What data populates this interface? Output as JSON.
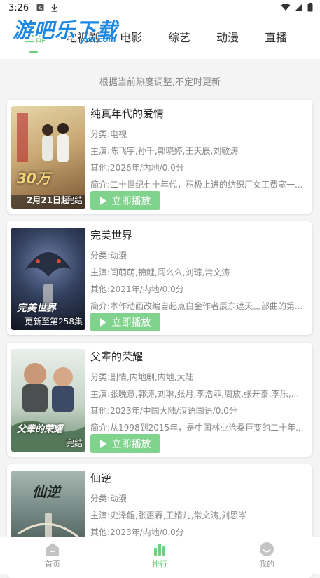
{
  "status_bar": {
    "time": "3:26",
    "icons": [
      "notification-a-icon",
      "download-icon",
      "wifi-icon",
      "signal-icon",
      "battery-icon"
    ]
  },
  "watermark": {
    "main": "游吧乐下载",
    "sub": "yx8.com"
  },
  "tabs": [
    {
      "label": "全部",
      "active": true
    },
    {
      "label": "电视剧",
      "active": false
    },
    {
      "label": "电影",
      "active": false
    },
    {
      "label": "综艺",
      "active": false
    },
    {
      "label": "动漫",
      "active": false
    },
    {
      "label": "直播",
      "active": false
    }
  ],
  "hint": "根据当前热度调整,不定时更新",
  "items": [
    {
      "title": "纯真年代的爱情",
      "category": "分类:电视",
      "cast": "主演:陈飞宇,孙千,郭晓婷,王天辰,刘敏涛",
      "other": "其他:2026年/内地/0.0分",
      "intro": "简介:二十世纪七十年代，积极上进的纺织厂女工费宽一...",
      "badge": "完结",
      "poster_text": "30万",
      "poster_bottom": "2月21日起",
      "play_label": "立即播放",
      "colors": [
        "#c9b27a",
        "#8a5f3a"
      ]
    },
    {
      "title": "完美世界",
      "category": "分类:动漫",
      "cast": "主演:闫萌萌,锦鲤,阎么么,刘琮,常文涛",
      "other": "其他:2021年/内地/0.0分",
      "intro": "简介:本作动画改编自起点白金作者辰东遮天三部曲的第...",
      "badge": "更新至第258集",
      "poster_text": "完美世界",
      "poster_bottom": "",
      "play_label": "立即播放",
      "colors": [
        "#3a4a6a",
        "#141a2a"
      ]
    },
    {
      "title": "父辈的荣耀",
      "category": "分类:剧情,内地剧,内地,大陆",
      "cast": "主演:张晚意,郭涛,刘琳,张月,李浩菲,周放,张开泰,李乐,...",
      "other": "其他:2023年/中国大陆/汉语国语/0.0分",
      "intro": "简介:从1998到2015年，是中国林业沧桑巨变的二十年...",
      "badge": "完结",
      "poster_text": "父辈的荣耀",
      "poster_bottom": "",
      "play_label": "立即播放",
      "colors": [
        "#cfd8d2",
        "#6b8f6f"
      ]
    },
    {
      "title": "仙逆",
      "category": "分类:动漫",
      "cast": "主演:史泽鲲,张惠霖,王婧儿,常文涛,刘思岑",
      "other": "其他:2023年/内地/0.0分",
      "intro": "",
      "badge": "",
      "poster_text": "仙逆",
      "poster_bottom": "",
      "play_label": "立即播放",
      "colors": [
        "#7a8d8a",
        "#2d3a38"
      ]
    }
  ],
  "nav": [
    {
      "label": "首页",
      "icon": "home-icon",
      "active": false
    },
    {
      "label": "排行",
      "icon": "ranking-icon",
      "active": true
    },
    {
      "label": "我的",
      "icon": "profile-icon",
      "active": false
    }
  ],
  "accent": "#6fcf7b"
}
